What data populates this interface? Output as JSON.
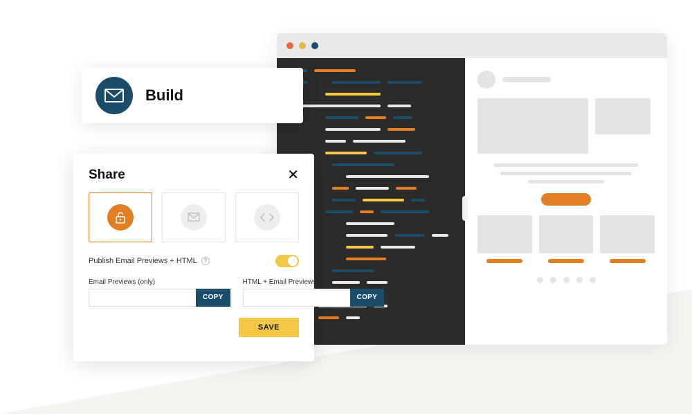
{
  "build": {
    "label": "Build",
    "icon": "envelope-icon"
  },
  "share": {
    "title": "Share",
    "options": [
      {
        "name": "public-option",
        "selected": true,
        "icon": "unlock-icon"
      },
      {
        "name": "email-option",
        "selected": false,
        "icon": "envelope-icon"
      },
      {
        "name": "code-option",
        "selected": false,
        "icon": "code-icon"
      }
    ],
    "publish_label": "Publish Email Previews + HTML",
    "publish_toggle": true,
    "field_a_label": "Email Previews (only)",
    "field_b_label": "HTML + Email Previews",
    "copy_label": "COPY",
    "save_label": "SAVE"
  },
  "colors": {
    "brand_navy": "#1b4d6b",
    "brand_orange": "#e27e23",
    "brand_yellow": "#f2c846"
  }
}
